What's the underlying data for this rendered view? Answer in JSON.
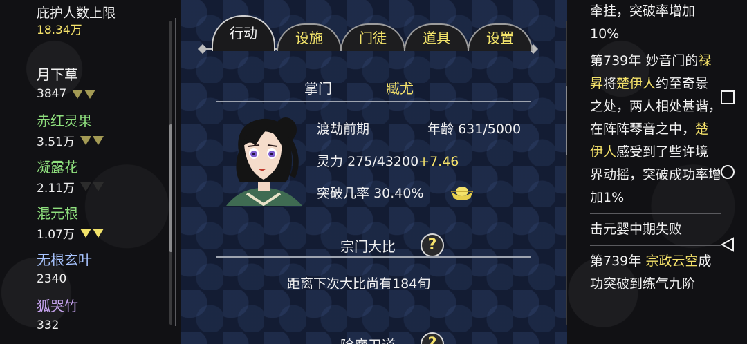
{
  "left": {
    "shelter_label": "庇护人数上限",
    "shelter_value": "18.34万",
    "resources": [
      {
        "name": "月下草",
        "amount": "3847",
        "arrows": 2,
        "arrow_style": "normal",
        "color": "#f2f2f2"
      },
      {
        "name": "赤红灵果",
        "amount": "3.51万",
        "arrows": 2,
        "arrow_style": "normal",
        "color": "#8fe07e"
      },
      {
        "name": "凝露花",
        "amount": "2.11万",
        "arrows": 2,
        "arrow_style": "dim",
        "color": "#8fe07e"
      },
      {
        "name": "混元根",
        "amount": "1.07万",
        "arrows": 2,
        "arrow_style": "bright",
        "color": "#8fe07e"
      },
      {
        "name": "无根玄叶",
        "amount": "2340",
        "arrows": 0,
        "arrow_style": "none",
        "color": "#a8c4ff"
      },
      {
        "name": "狐哭竹",
        "amount": "332",
        "arrows": 0,
        "arrow_style": "none",
        "color": "#c7a4f0"
      }
    ]
  },
  "tabs": [
    {
      "label": "行动",
      "active": true
    },
    {
      "label": "设施",
      "active": false
    },
    {
      "label": "门徒",
      "active": false
    },
    {
      "label": "道具",
      "active": false
    },
    {
      "label": "设置",
      "active": false
    }
  ],
  "leader": {
    "label": "掌门",
    "name": "臧尤",
    "realm": "渡劫前期",
    "age_label": "年龄",
    "age_value": "631/5000",
    "spirit_label": "灵力",
    "spirit_value": "275/43200",
    "spirit_rate": "+7.46",
    "breakthrough_label": "突破几率",
    "breakthrough_value": "30.40%"
  },
  "tournament": {
    "title": "宗门大比",
    "help": "?",
    "countdown": "距离下次大比尚有184旬"
  },
  "next_section": {
    "title": "除魔卫道",
    "help": "?"
  },
  "log": {
    "entry1_text": "牵挂，突破率增加10%",
    "entry2": {
      "year": "第739年",
      "sect": "妙音门的",
      "name_a": "禄昇",
      "mid": "将",
      "name_b": "楚伊人",
      "text1": "约至奇景之处，两人相处甚谐，在阵阵琴音之中，",
      "name_c": "楚伊人",
      "text2": "感受到了些许境界动摇，突破成功率增加1%"
    },
    "entry3_text": "击元婴中期失败",
    "entry4": {
      "year": "第739年",
      "name": "宗政云空",
      "text": "成功突破到练气九阶"
    }
  },
  "nav": {
    "square_icon": "square-icon",
    "circle_icon": "circle-icon",
    "back_icon": "back-triangle-icon"
  },
  "colors": {
    "gold": "#f5e26a",
    "green": "#8fe07e",
    "blue": "#a8c4ff",
    "purple": "#c7a4f0",
    "panel_bg": "#131c33"
  }
}
